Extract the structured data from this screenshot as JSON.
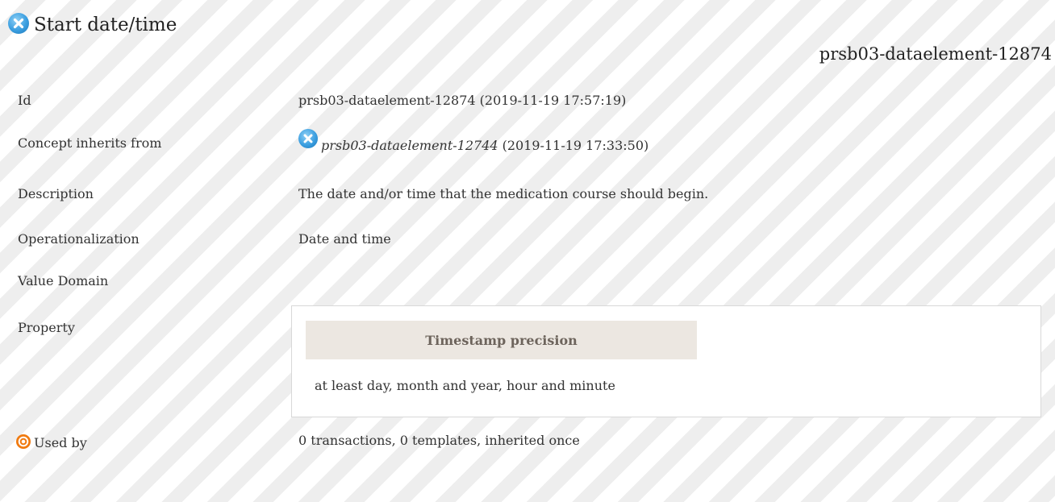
{
  "header": {
    "status_icon": "cancelled-x-icon",
    "title": "Start date/time",
    "id": "prsb03-dataelement-12874"
  },
  "rows": {
    "id": {
      "label": "Id",
      "value": "prsb03-dataelement-12874 (2019-11-19 17:57:19)"
    },
    "inherits": {
      "label": "Concept inherits from",
      "icon": "cancelled-x-icon",
      "ref": "prsb03-dataelement-12744",
      "date": "(2019-11-19 17:33:50)"
    },
    "description": {
      "label": "Description",
      "value": "The date and/or time that the medication course should begin."
    },
    "operationalization": {
      "label": "Operationalization",
      "value": "Date and time"
    },
    "value_domain": {
      "label": "Value Domain"
    },
    "property": {
      "label": "Property",
      "header": "Timestamp precision",
      "value": "at least day, month and year, hour and minute"
    },
    "used_by": {
      "label": "Used by",
      "icon": "target-icon",
      "value": "0 transactions, 0 templates, inherited once"
    }
  },
  "colors": {
    "stripe": "#eeeeee",
    "status_blue": "#3a9ee0",
    "property_header_bg": "#ece7e1",
    "target_orange": "#f07a10"
  }
}
